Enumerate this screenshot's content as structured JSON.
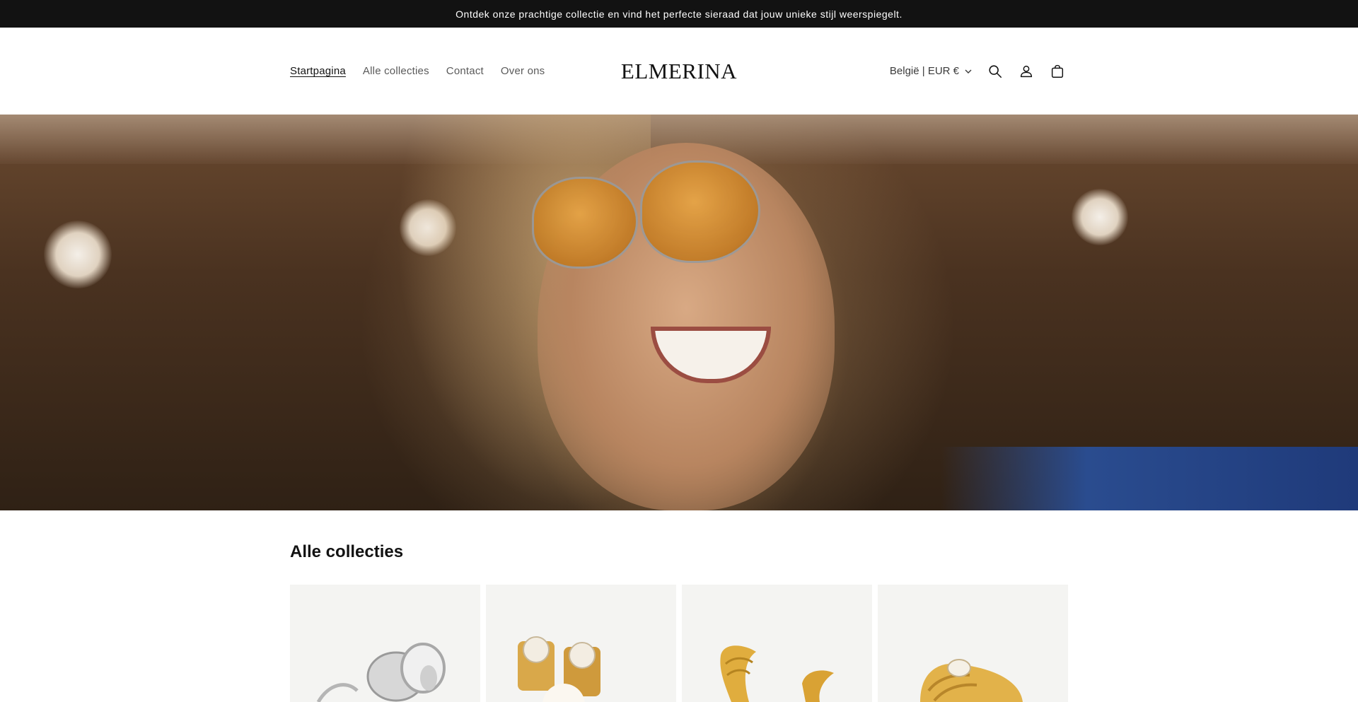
{
  "announcement": {
    "text": "Ontdek onze prachtige collectie en vind het perfecte sieraad dat jouw unieke stijl weerspiegelt."
  },
  "header": {
    "logo": "ELMERINA",
    "nav": [
      {
        "label": "Startpagina",
        "active": true
      },
      {
        "label": "Alle collecties",
        "active": false
      },
      {
        "label": "Contact",
        "active": false
      },
      {
        "label": "Over ons",
        "active": false
      }
    ],
    "country_selector": "België | EUR €",
    "icons": [
      "chevron-down-icon",
      "search-icon",
      "account-icon",
      "cart-icon"
    ]
  },
  "hero": {
    "image": "woman-with-orange-sunglasses-and-rings"
  },
  "collections": {
    "title": "Alle collecties",
    "cards": [
      {
        "image": "silver-rings"
      },
      {
        "image": "gold-pearl-earrings"
      },
      {
        "image": "gold-wave-earrings"
      },
      {
        "image": "gold-pearl-ring"
      }
    ]
  },
  "colors": {
    "announcement_bg": "#121212",
    "text": "#121212",
    "card_bg": "#f4f4f2"
  }
}
